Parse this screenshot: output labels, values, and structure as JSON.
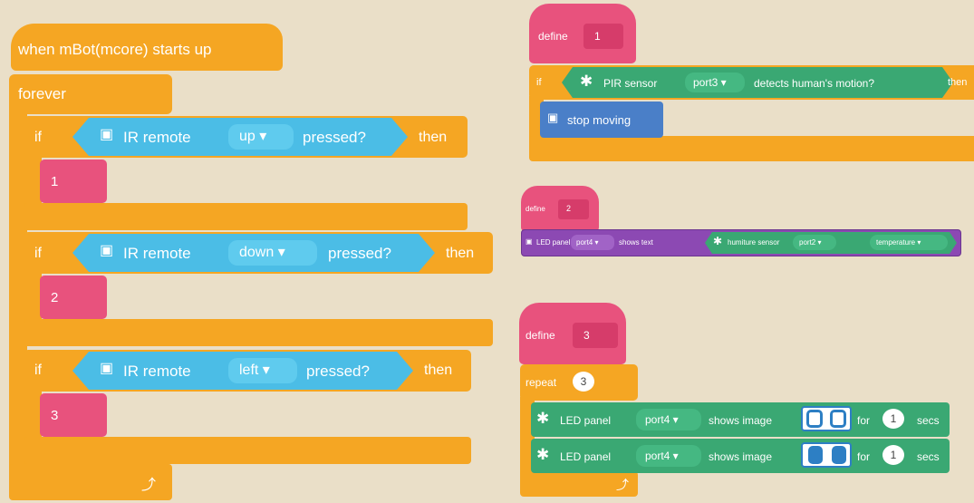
{
  "main_script": {
    "hat_label": "when mBot(mcore) starts up",
    "forever_label": "forever",
    "if_label": "if",
    "then_label": "then",
    "pressed_label": "pressed?",
    "ir_label": "IR remote",
    "branches": [
      {
        "key": "up ▾",
        "call": "1"
      },
      {
        "key": "down ▾",
        "call": "2"
      },
      {
        "key": "left ▾",
        "call": "3"
      }
    ],
    "loop_arrow": "⤴"
  },
  "define1": {
    "define_label": "define",
    "name": "1",
    "if_label": "if",
    "sensor_label": "PIR sensor",
    "port": "port3 ▾",
    "detects_label": "detects human's motion?",
    "then_label": "then",
    "stop_label": "stop moving"
  },
  "define2": {
    "define_label": "define",
    "name": "2",
    "led_label": "LED panel",
    "port": "port4 ▾",
    "shows_text_label": "shows text",
    "humiture_label": "humiture sensor",
    "humiture_port": "port2 ▾",
    "measure": "temperature ▾"
  },
  "define3": {
    "define_label": "define",
    "name": "3",
    "repeat_label": "repeat",
    "repeat_count": "3",
    "led_label": "LED panel",
    "port": "port4 ▾",
    "shows_image_label": "shows image",
    "for_label": "for",
    "secs_label": "secs",
    "secs1": "1",
    "secs2": "1",
    "loop_arrow": "⤴"
  },
  "colors": {
    "background": "#eadfc8",
    "control": "#f5a623",
    "define": "#e8527d",
    "ir_sensor": "#4bbde6",
    "led_extension": "#3aa873",
    "led_text_block": "#8c49b3",
    "motion": "#4a7fc8"
  },
  "icons": [
    "robot-icon",
    "puzzle-icon",
    "loop-arrow-icon"
  ]
}
